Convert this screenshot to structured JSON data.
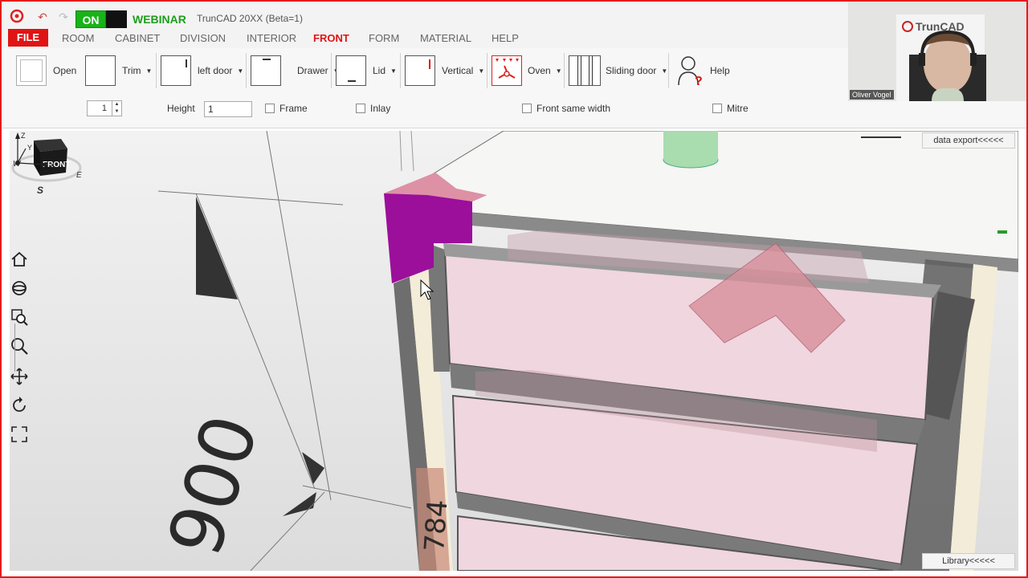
{
  "titlebar": {
    "toggle_on": "ON",
    "webinar": "WEBINAR",
    "app_title": "TrunCAD 20XX (Beta=1)"
  },
  "menu": {
    "file": "FILE",
    "items": [
      "ROOM",
      "CABINET",
      "DIVISION",
      "INTERIOR",
      "FRONT",
      "FORM",
      "MATERIAL",
      "HELP"
    ],
    "active": "FRONT"
  },
  "ribbon": {
    "buttons": [
      "Open",
      "Trim",
      "left door",
      "Drawer",
      "Lid",
      "Vertical",
      "Oven",
      "Sliding door",
      "Help"
    ],
    "spin_value": "1",
    "height_label": "Height",
    "height_value": "1",
    "frame": "Frame",
    "inlay": "Inlay",
    "front_same_width": "Front same width",
    "mitre": "Mitre"
  },
  "webcam": {
    "name": "Oliver Vogel",
    "brand": "TrunCAD"
  },
  "viewport": {
    "data_export": "data export<<<<<",
    "library": "Library<<<<<",
    "dimension_900": "900",
    "dimension_784": "784",
    "navcube_face": "FRONT",
    "compass_w": "W",
    "compass_e": "E",
    "compass_s": "S",
    "axis_z": "Z",
    "axis_y": "Y",
    "axis_x": "X"
  },
  "colors": {
    "accent": "#e01414",
    "on_green": "#19b219",
    "webinar_green": "#1c9e1c",
    "highlight_purple": "#9b0f9b",
    "front_pink": "#f0d6de"
  }
}
